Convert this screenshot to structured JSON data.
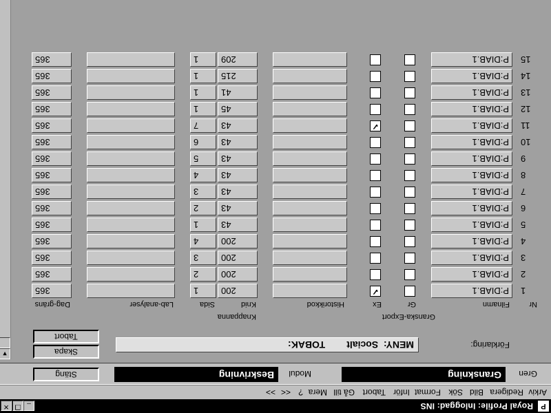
{
  "window": {
    "title": "Royal Profile: Inloggad: INS",
    "icon_glyph": "P",
    "minimize_glyph": "_",
    "restore_glyph": "❐",
    "close_glyph": "✕"
  },
  "menu": [
    "Arkiv",
    "Redigera",
    "Bild",
    "Sök",
    "Format",
    "Inför",
    "Tabort",
    "Gå till",
    "Mera",
    "?",
    "<<",
    ">>"
  ],
  "top_panel": {
    "gren_label": "Gren",
    "gren_value": "Granskning",
    "modul_label": "Modul",
    "modul_value": "Beskrivning"
  },
  "buttons": {
    "stang": "Stäng",
    "skapa": "Skapa",
    "tabort": "Tabort"
  },
  "description": {
    "label": "Förklaring:",
    "value": "MENY:  Socialt        TOBAK:"
  },
  "headers": {
    "nr": "Nr",
    "filnamn": "Filnamn",
    "gr": "Gr",
    "ex": "Ex",
    "granska_export": "Granska-Export",
    "historikkod": "Historikkod",
    "knid": "Knid",
    "sida": "Sida",
    "knappanna": "Knappanna",
    "lab_analyser": "Lab-analyser",
    "dag_grans": "Dag-gräns"
  },
  "rows": [
    {
      "nr": "1",
      "filnamn": "P:DIAB.1",
      "gr": false,
      "ex": true,
      "historik": "",
      "knid": "200",
      "sida": "1",
      "lab": "",
      "dag": "365"
    },
    {
      "nr": "2",
      "filnamn": "P:DIAB.1",
      "gr": false,
      "ex": false,
      "historik": "",
      "knid": "200",
      "sida": "2",
      "lab": "",
      "dag": "365"
    },
    {
      "nr": "3",
      "filnamn": "P:DIAB.1",
      "gr": false,
      "ex": false,
      "historik": "",
      "knid": "200",
      "sida": "3",
      "lab": "",
      "dag": "365"
    },
    {
      "nr": "4",
      "filnamn": "P:DIAB.1",
      "gr": false,
      "ex": false,
      "historik": "",
      "knid": "200",
      "sida": "4",
      "lab": "",
      "dag": "365"
    },
    {
      "nr": "5",
      "filnamn": "P:DIAB.1",
      "gr": false,
      "ex": false,
      "historik": "",
      "knid": "43",
      "sida": "1",
      "lab": "",
      "dag": "365"
    },
    {
      "nr": "6",
      "filnamn": "P:DIAB.1",
      "gr": false,
      "ex": false,
      "historik": "",
      "knid": "43",
      "sida": "2",
      "lab": "",
      "dag": "365"
    },
    {
      "nr": "7",
      "filnamn": "P:DIAB.1",
      "gr": false,
      "ex": false,
      "historik": "",
      "knid": "43",
      "sida": "3",
      "lab": "",
      "dag": "365"
    },
    {
      "nr": "8",
      "filnamn": "P:DIAB.1",
      "gr": false,
      "ex": false,
      "historik": "",
      "knid": "43",
      "sida": "4",
      "lab": "",
      "dag": "365"
    },
    {
      "nr": "9",
      "filnamn": "P:DIAB.1",
      "gr": false,
      "ex": false,
      "historik": "",
      "knid": "43",
      "sida": "5",
      "lab": "",
      "dag": "365"
    },
    {
      "nr": "10",
      "filnamn": "P:DIAB.1",
      "gr": false,
      "ex": false,
      "historik": "",
      "knid": "43",
      "sida": "6",
      "lab": "",
      "dag": "365"
    },
    {
      "nr": "11",
      "filnamn": "P:DIAB.1",
      "gr": false,
      "ex": true,
      "historik": "",
      "knid": "43",
      "sida": "7",
      "lab": "",
      "dag": "365"
    },
    {
      "nr": "12",
      "filnamn": "P:DIAB.1",
      "gr": false,
      "ex": false,
      "historik": "",
      "knid": "45",
      "sida": "1",
      "lab": "",
      "dag": "365"
    },
    {
      "nr": "13",
      "filnamn": "P:DIAB.1",
      "gr": false,
      "ex": false,
      "historik": "",
      "knid": "41",
      "sida": "1",
      "lab": "",
      "dag": "365"
    },
    {
      "nr": "14",
      "filnamn": "P:DIAB.1",
      "gr": false,
      "ex": false,
      "historik": "",
      "knid": "215",
      "sida": "1",
      "lab": "",
      "dag": "365"
    },
    {
      "nr": "15",
      "filnamn": "P:DIAB.1",
      "gr": false,
      "ex": false,
      "historik": "",
      "knid": "209",
      "sida": "1",
      "lab": "",
      "dag": "365"
    }
  ],
  "check_glyph": "✓",
  "scroll": {
    "up": "▲",
    "down": "▼"
  },
  "colors": {
    "background": "#a0a0a0",
    "panel": "#c0c0c0",
    "titlebar": "#000000"
  }
}
